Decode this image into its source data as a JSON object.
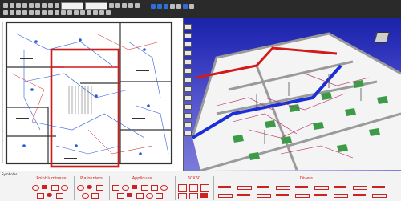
{
  "toolbar": {
    "icons": [
      "folder-icon",
      "save-icon",
      "print-icon",
      "undo-icon",
      "redo-icon",
      "zoom-icon",
      "pan-icon",
      "layer-icon",
      "select-icon",
      "grid-icon",
      "measure-icon",
      "settings-icon",
      "ai-icon",
      "layout-icon",
      "3d-icon"
    ],
    "selector_value": ""
  },
  "panels": {
    "plan": {
      "name": "floor-plan"
    },
    "view3d": {
      "name": "3d-view"
    }
  },
  "palette": {
    "title": "Symboles",
    "groups": [
      {
        "label": "Point lumineux"
      },
      {
        "label": "Plafonniers"
      },
      {
        "label": "Appliques"
      },
      {
        "label": "60X60"
      },
      {
        "label": "Divers"
      }
    ]
  },
  "colors": {
    "accent_red": "#d11a1a",
    "accent_blue": "#2233cc",
    "sky": "#2a2fb8",
    "toolbar": "#2a2a2a"
  }
}
